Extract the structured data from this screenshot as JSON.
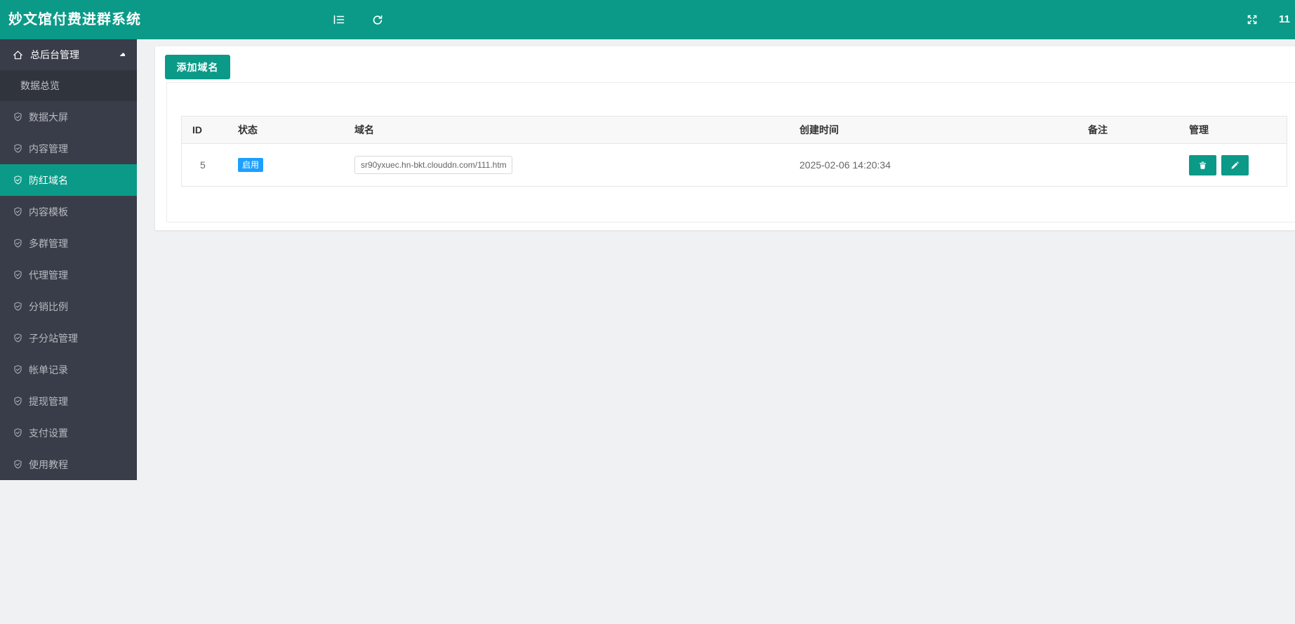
{
  "colors": {
    "accent": "#0b9a88",
    "badge": "#1e9fff",
    "sidebar": "#393d49",
    "submenu": "#30343d",
    "page": "#f0f1f2"
  },
  "header": {
    "title": "妙文馆付费进群系统",
    "collapse_icon": "menu-fold-icon",
    "refresh_icon": "refresh-icon",
    "fullscreen_icon": "fullscreen-expand-icon",
    "username": "11"
  },
  "sidebar": {
    "parent": {
      "label": "总后台管理",
      "icon": "home-icon",
      "state": "expanded",
      "caret": "caret-up-icon"
    },
    "submenu": [
      {
        "label": "数据总览"
      }
    ],
    "items": [
      {
        "label": "数据大屏",
        "icon": "shield-check-icon",
        "active": false
      },
      {
        "label": "内容管理",
        "icon": "shield-check-icon",
        "active": false
      },
      {
        "label": "防红域名",
        "icon": "shield-check-icon",
        "active": true
      },
      {
        "label": "内容模板",
        "icon": "shield-check-icon",
        "active": false
      },
      {
        "label": "多群管理",
        "icon": "shield-check-icon",
        "active": false
      },
      {
        "label": "代理管理",
        "icon": "shield-check-icon",
        "active": false
      },
      {
        "label": "分销比例",
        "icon": "shield-check-icon",
        "active": false
      },
      {
        "label": "子分站管理",
        "icon": "shield-check-icon",
        "active": false
      },
      {
        "label": "帐单记录",
        "icon": "shield-check-icon",
        "active": false
      },
      {
        "label": "提现管理",
        "icon": "shield-check-icon",
        "active": false
      },
      {
        "label": "支付设置",
        "icon": "shield-check-icon",
        "active": false
      },
      {
        "label": "使用教程",
        "icon": "shield-check-icon",
        "active": false
      }
    ]
  },
  "main": {
    "add_button_label": "添加域名",
    "table": {
      "columns": [
        "ID",
        "状态",
        "域名",
        "创建时间",
        "备注",
        "管理"
      ],
      "row": {
        "id": "5",
        "status": "启用",
        "domain": "sr90yxuec.hn-bkt.clouddn.com/111.htm",
        "created_at": "2025-02-06 14:20:34",
        "remark": "",
        "actions": [
          "delete",
          "edit"
        ]
      }
    }
  }
}
